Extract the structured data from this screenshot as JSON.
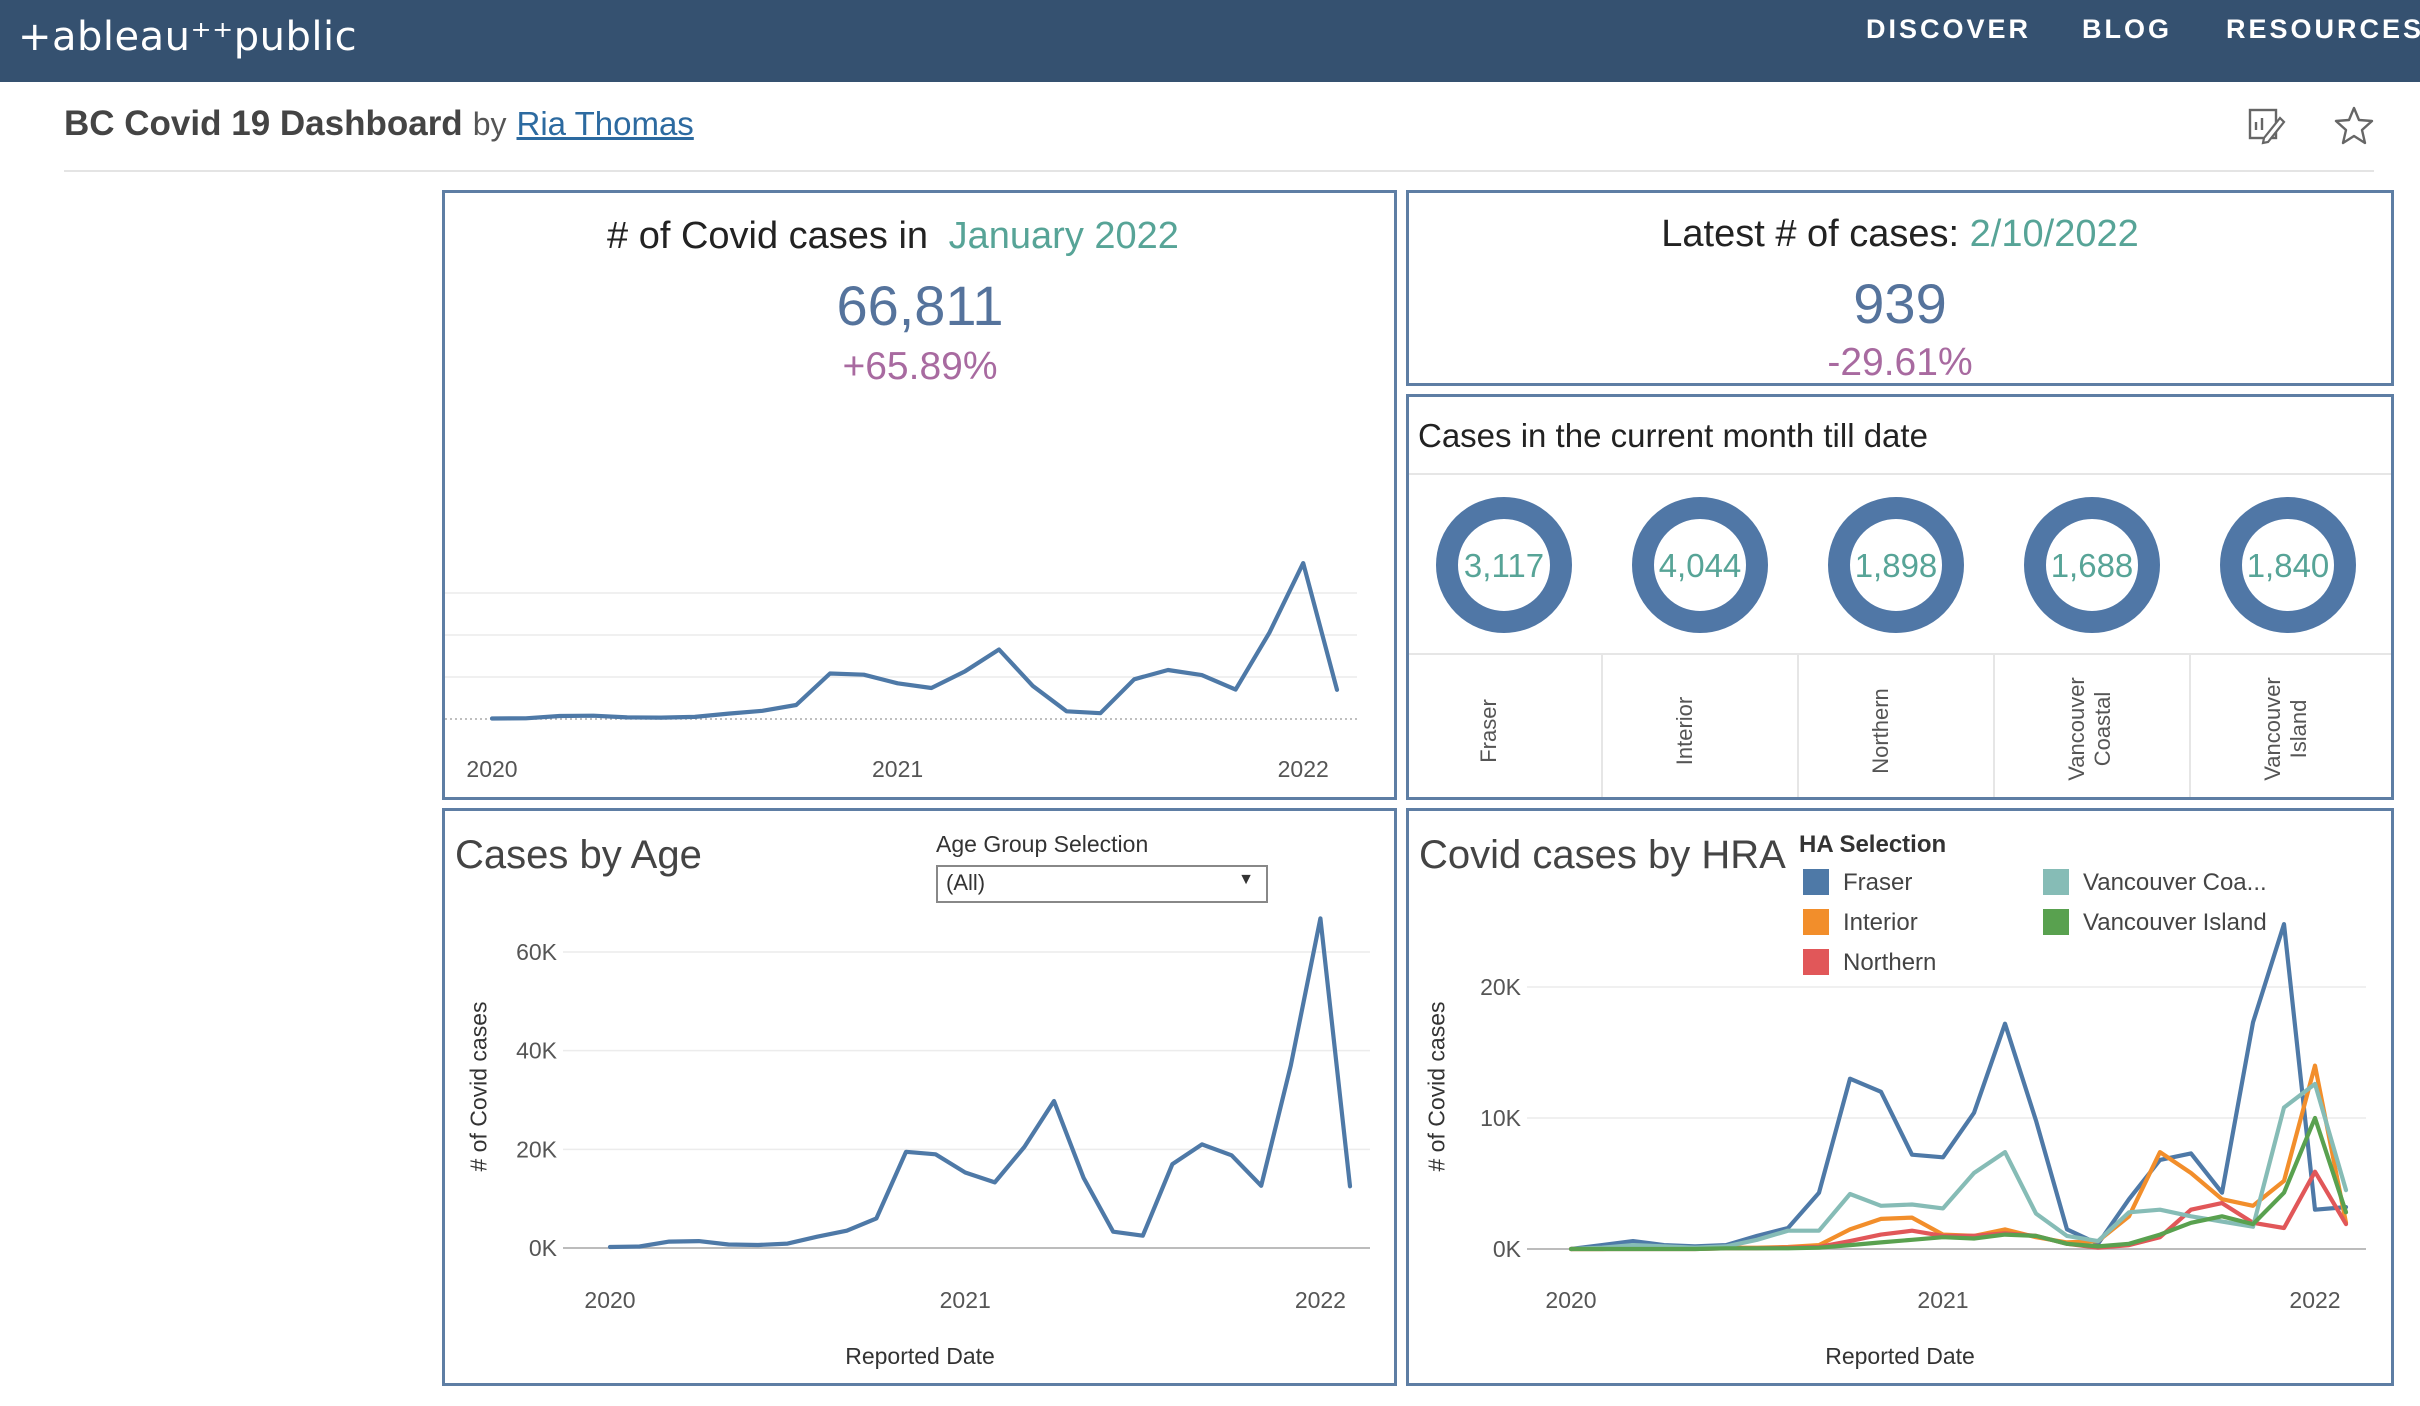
{
  "brand": {
    "logo_text": "+ableau⁺⁺public"
  },
  "nav": {
    "items": [
      "DISCOVER",
      "BLOG",
      "RESOURCES"
    ]
  },
  "viz": {
    "title": "BC Covid 19 Dashboard",
    "by": "by",
    "author": "Ria Thomas"
  },
  "kpi_month": {
    "title_prefix": "# of Covid cases in",
    "title_period": "January 2022",
    "value": "66,811",
    "change": "+65.89%"
  },
  "kpi_latest": {
    "title_prefix": "Latest # of cases:",
    "title_date": "2/10/2022",
    "value": "939",
    "change": "-29.61%"
  },
  "current_month": {
    "title": "Cases in the current month till date",
    "regions": [
      {
        "value": "3,117",
        "line1": "Fraser",
        "line2": ""
      },
      {
        "value": "4,044",
        "line1": "Interior",
        "line2": ""
      },
      {
        "value": "1,898",
        "line1": "Northern",
        "line2": ""
      },
      {
        "value": "1,688",
        "line1": "Vancouver",
        "line2": "Coastal"
      },
      {
        "value": "1,840",
        "line1": "Vancouver",
        "line2": "Island"
      }
    ]
  },
  "age_panel": {
    "title": "Cases by Age",
    "filter_label": "Age Group Selection",
    "filter_value": "(All)",
    "ylabel": "# of Covid cases",
    "xlabel": "Reported Date"
  },
  "hra_panel": {
    "title": "Covid cases by HRA",
    "legend_title": "HA Selection",
    "ylabel": "# of Covid cases",
    "xlabel": "Reported Date"
  },
  "colors": {
    "fraser": "#4e79a7",
    "interior": "#f28e2b",
    "northern": "#e15759",
    "vancouver_coastal": "#86bcb6",
    "vancouver_island": "#59a14f",
    "accent_teal": "#57a497",
    "pct_purple": "#a86aa0",
    "border": "#5e7ea4"
  },
  "chart_data": [
    {
      "type": "line",
      "x": [
        "2020-01",
        "2020-02",
        "2020-03",
        "2020-04",
        "2020-05",
        "2020-06",
        "2020-07",
        "2020-08",
        "2020-09",
        "2020-10",
        "2020-11",
        "2020-12",
        "2021-01",
        "2021-02",
        "2021-03",
        "2021-04",
        "2021-05",
        "2021-06",
        "2021-07",
        "2021-08",
        "2021-09",
        "2021-10",
        "2021-11",
        "2021-12",
        "2022-01",
        "2022-02"
      ],
      "series": [
        {
          "values": [
            200,
            300,
            1300,
            1400,
            700,
            600,
            900,
            2300,
            3500,
            6000,
            19500,
            19000,
            15300,
            13300,
            20500,
            29800,
            14200,
            3300,
            2500,
            17000,
            21000,
            18800,
            12600,
            37000,
            66811,
            12500
          ]
        }
      ],
      "xticks": [
        "2020",
        "2021",
        "2022"
      ],
      "ylim": [
        0,
        72000
      ]
    },
    {
      "type": "line",
      "x": [
        "2020-01",
        "2020-02",
        "2020-03",
        "2020-04",
        "2020-05",
        "2020-06",
        "2020-07",
        "2020-08",
        "2020-09",
        "2020-10",
        "2020-11",
        "2020-12",
        "2021-01",
        "2021-02",
        "2021-03",
        "2021-04",
        "2021-05",
        "2021-06",
        "2021-07",
        "2021-08",
        "2021-09",
        "2021-10",
        "2021-11",
        "2021-12",
        "2022-01",
        "2022-02"
      ],
      "series": [
        {
          "values": [
            200,
            300,
            1300,
            1400,
            700,
            600,
            900,
            2300,
            3500,
            6000,
            19500,
            19000,
            15300,
            13300,
            20500,
            29800,
            14200,
            3300,
            2500,
            17000,
            21000,
            18800,
            12600,
            37000,
            66811,
            12500
          ]
        }
      ],
      "xlabel": "Reported Date",
      "ylabel": "# of Covid cases",
      "xticks": [
        "2020",
        "2021",
        "2022"
      ],
      "yticks": [
        "0K",
        "20K",
        "40K",
        "60K"
      ],
      "ylim": [
        0,
        70000
      ]
    },
    {
      "type": "line",
      "x": [
        "2020-01",
        "2020-02",
        "2020-03",
        "2020-04",
        "2020-05",
        "2020-06",
        "2020-07",
        "2020-08",
        "2020-09",
        "2020-10",
        "2020-11",
        "2020-12",
        "2021-01",
        "2021-02",
        "2021-03",
        "2021-04",
        "2021-05",
        "2021-06",
        "2021-07",
        "2021-08",
        "2021-09",
        "2021-10",
        "2021-11",
        "2021-12",
        "2022-01",
        "2022-02"
      ],
      "series": [
        {
          "name": "Fraser",
          "color": "#4e79a7",
          "values": [
            0,
            300,
            600,
            300,
            200,
            300,
            1000,
            1600,
            4300,
            13000,
            12000,
            7200,
            7000,
            10400,
            17200,
            9800,
            1500,
            400,
            3800,
            6800,
            7300,
            4300,
            17300,
            24800,
            3000,
            3200
          ]
        },
        {
          "name": "Interior",
          "color": "#f28e2b",
          "values": [
            0,
            0,
            50,
            50,
            50,
            100,
            100,
            150,
            300,
            1500,
            2300,
            2400,
            1100,
            1000,
            1500,
            900,
            500,
            600,
            2500,
            7400,
            5800,
            3800,
            3300,
            5200,
            14000,
            2000
          ]
        },
        {
          "name": "Northern",
          "color": "#e15759",
          "values": [
            0,
            0,
            0,
            0,
            0,
            50,
            50,
            100,
            150,
            600,
            1100,
            1400,
            1000,
            1000,
            1200,
            1000,
            400,
            100,
            300,
            900,
            3000,
            3500,
            2000,
            1600,
            5900,
            1900
          ]
        },
        {
          "name": "Vancouver Coa...",
          "color": "#86bcb6",
          "values": [
            0,
            100,
            300,
            200,
            100,
            200,
            700,
            1400,
            1400,
            4200,
            3300,
            3400,
            3100,
            5800,
            7400,
            2700,
            1000,
            600,
            2800,
            3000,
            2500,
            2100,
            1700,
            10800,
            12600,
            4500
          ]
        },
        {
          "name": "Vancouver Island",
          "color": "#59a14f",
          "values": [
            0,
            0,
            0,
            0,
            0,
            50,
            50,
            50,
            100,
            300,
            500,
            700,
            900,
            800,
            1100,
            1000,
            400,
            200,
            400,
            1100,
            2000,
            2500,
            1900,
            4300,
            10000,
            2800
          ]
        }
      ],
      "xlabel": "Reported Date",
      "ylabel": "# of Covid cases",
      "xticks": [
        "2020",
        "2021",
        "2022"
      ],
      "yticks": [
        "0K",
        "10K",
        "20K"
      ],
      "ylim": [
        0,
        26000
      ],
      "legend": "top-right"
    }
  ]
}
